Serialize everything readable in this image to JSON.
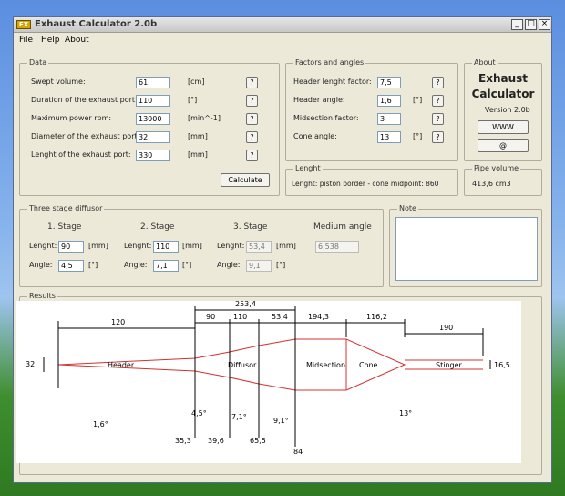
{
  "window": {
    "title": "Exhaust Calculator 2.0b",
    "icon_text": "EX",
    "controls": [
      "_",
      "□",
      "×"
    ]
  },
  "menu": [
    "File",
    "Help",
    "About"
  ],
  "data": {
    "legend": "Data",
    "rows": [
      {
        "label": "Swept volume:",
        "value": "61",
        "unit": "[cm]"
      },
      {
        "label": "Duration of the exhaust port:",
        "value": "110",
        "unit": "[°]"
      },
      {
        "label": "Maximum power rpm:",
        "value": "13000",
        "unit": "[min^-1]"
      },
      {
        "label": "Diameter of the exhaust port:",
        "value": "32",
        "unit": "[mm]"
      },
      {
        "label": "Lenght of the exhaust port:",
        "value": "330",
        "unit": "[mm]"
      }
    ],
    "help_label": "?",
    "calculate_label": "Calculate"
  },
  "factors": {
    "legend": "Factors and angles",
    "rows": [
      {
        "label": "Header lenght factor:",
        "value": "7,5",
        "unit": ""
      },
      {
        "label": "Header angle:",
        "value": "1,6",
        "unit": "[°]"
      },
      {
        "label": "Midsection factor:",
        "value": "3",
        "unit": ""
      },
      {
        "label": "Cone angle:",
        "value": "13",
        "unit": "[°]"
      }
    ],
    "help_label": "?"
  },
  "about": {
    "legend": "About",
    "line1": "Exhaust",
    "line2": "Calculator",
    "version": "Version 2.0b",
    "www_label": "WWW",
    "mail_label": "@"
  },
  "lenght": {
    "legend": "Lenght",
    "text": "Lenght: piston border - cone midpoint: 860"
  },
  "pipe_volume": {
    "legend": "Pipe volume",
    "text": "413,6 cm3"
  },
  "diffusor": {
    "legend": "Three stage diffusor",
    "stages": [
      {
        "title": "1. Stage",
        "len_label": "Lenght:",
        "len_value": "90",
        "len_unit": "[mm]",
        "ang_label": "Angle:",
        "ang_value": "4,5",
        "ang_unit": "[°]"
      },
      {
        "title": "2. Stage",
        "len_label": "Lenght:",
        "len_value": "110",
        "len_unit": "[mm]",
        "ang_label": "Angle:",
        "ang_value": "7,1",
        "ang_unit": "[°]"
      },
      {
        "title": "3. Stage",
        "len_label": "Lenght:",
        "len_value": "53,4",
        "len_unit": "[mm]",
        "ang_label": "Angle:",
        "ang_value": "9,1",
        "ang_unit": "[°]"
      }
    ],
    "medium_angle_label": "Medium angle",
    "medium_angle_value": "6,538"
  },
  "note": {
    "legend": "Note"
  },
  "results": {
    "legend": "Results",
    "sections": [
      "Header",
      "Diffusor",
      "Midsection",
      "Cone",
      "Stinger"
    ],
    "dims_top": [
      "120",
      "90",
      "253,4",
      "110",
      "53,4",
      "194,3",
      "116,2",
      "190"
    ],
    "inlet_diameter": "32",
    "stinger_diameter": "16,5",
    "bottom_labels": [
      "1,6°",
      "4,5°",
      "7,1°",
      "9,1°",
      "13°",
      "35,3",
      "39,6",
      "65,5",
      "84"
    ]
  },
  "colors": {
    "pipe": "#d43030",
    "dims": "#000000"
  }
}
